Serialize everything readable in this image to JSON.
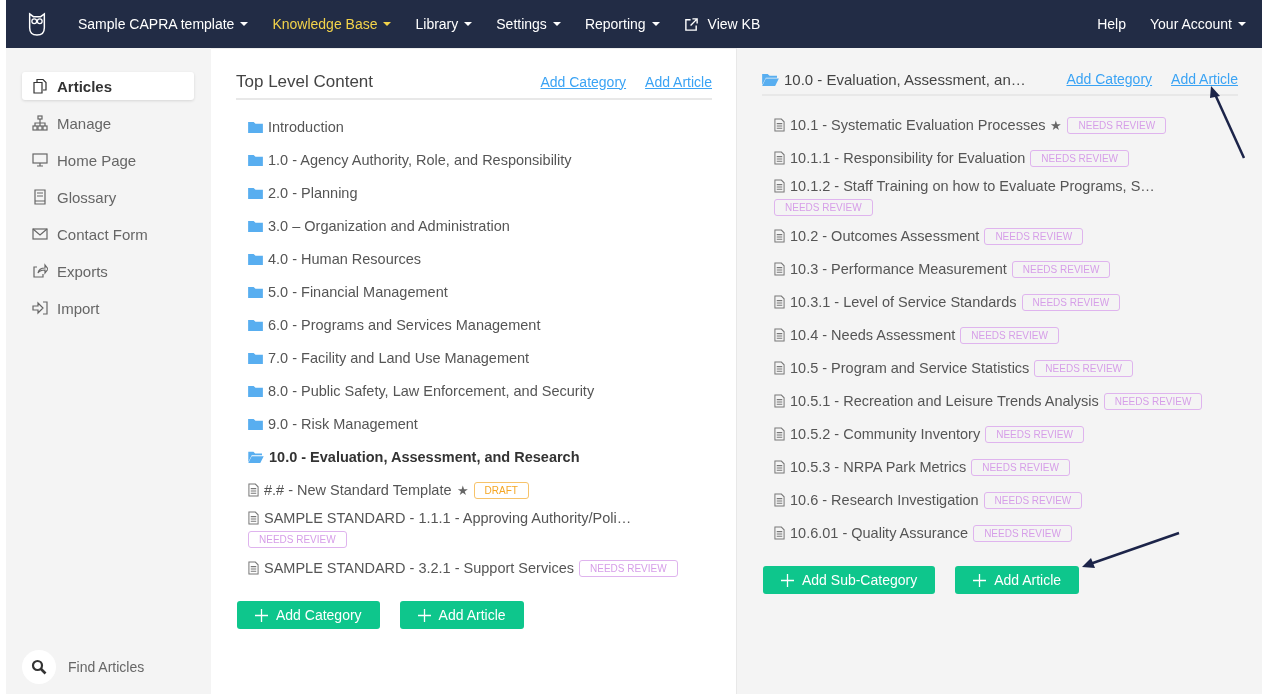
{
  "nav": {
    "items": [
      {
        "label": "Sample CAPRA template",
        "kind": "dropdown",
        "selected": false
      },
      {
        "label": "Knowledge Base",
        "kind": "dropdown",
        "selected": true
      },
      {
        "label": "Library",
        "kind": "dropdown",
        "selected": false
      },
      {
        "label": "Settings",
        "kind": "dropdown",
        "selected": false
      },
      {
        "label": "Reporting",
        "kind": "dropdown",
        "selected": false
      },
      {
        "label": "View KB",
        "kind": "external",
        "selected": false
      }
    ],
    "right": [
      {
        "label": "Help",
        "kind": "link"
      },
      {
        "label": "Your Account",
        "kind": "dropdown"
      }
    ]
  },
  "sidebar": {
    "items": [
      {
        "label": "Articles",
        "selected": true
      },
      {
        "label": "Manage",
        "selected": false
      },
      {
        "label": "Home Page",
        "selected": false
      },
      {
        "label": "Glossary",
        "selected": false
      },
      {
        "label": "Contact Form",
        "selected": false
      },
      {
        "label": "Exports",
        "selected": false
      },
      {
        "label": "Import",
        "selected": false
      }
    ],
    "search": {
      "label": "Find Articles"
    }
  },
  "panels": [
    {
      "title": "Top Level Content",
      "kind": "plain",
      "links": [
        "Add Category",
        "Add Article"
      ],
      "items": [
        {
          "kind": "folder",
          "label": "Introduction",
          "open": false
        },
        {
          "kind": "folder",
          "label": "1.0 - Agency Authority, Role, and Responsibility",
          "open": false
        },
        {
          "kind": "folder",
          "label": "2.0 - Planning",
          "open": false
        },
        {
          "kind": "folder",
          "label": "3.0 – Organization and Administration",
          "open": false
        },
        {
          "kind": "folder",
          "label": "4.0 - Human Resources",
          "open": false
        },
        {
          "kind": "folder",
          "label": "5.0 - Financial Management",
          "open": false
        },
        {
          "kind": "folder",
          "label": "6.0 - Programs and Services Management",
          "open": false
        },
        {
          "kind": "folder",
          "label": "7.0 - Facility and Land Use Management",
          "open": false
        },
        {
          "kind": "folder",
          "label": "8.0 - Public Safety, Law Enforcement, and Security",
          "open": false
        },
        {
          "kind": "folder",
          "label": "9.0 - Risk Management",
          "open": false
        },
        {
          "kind": "folder",
          "label": "10.0 - Evaluation, Assessment, and Research",
          "open": true
        },
        {
          "kind": "article",
          "label": "#.# - New Standard Template",
          "star": "★",
          "badge": {
            "text": "DRAFT",
            "kind": "draft"
          }
        },
        {
          "kind": "article",
          "label": "SAMPLE STANDARD - 1.1.1 - Approving Authority/Poli…",
          "badge": {
            "text": "NEEDS REVIEW",
            "kind": "review"
          }
        },
        {
          "kind": "article",
          "label": "SAMPLE STANDARD - 3.2.1 - Support Services",
          "badge": {
            "text": "NEEDS REVIEW",
            "kind": "review"
          }
        }
      ],
      "buttons": [
        "Add Category",
        "Add Article"
      ]
    },
    {
      "title": "10.0 - Evaluation, Assessment, an…",
      "kind": "folder",
      "links": [
        "Add Category",
        "Add Article"
      ],
      "items": [
        {
          "kind": "article",
          "label": "10.1 - Systematic Evaluation Processes",
          "star": "★",
          "badge": {
            "text": "NEEDS REVIEW",
            "kind": "review"
          }
        },
        {
          "kind": "article",
          "label": "10.1.1 - Responsibility for Evaluation",
          "badge": {
            "text": "NEEDS REVIEW",
            "kind": "review"
          }
        },
        {
          "kind": "article",
          "label": "10.1.2 - Staff Training on how to Evaluate Programs, S…",
          "badge": {
            "text": "NEEDS REVIEW",
            "kind": "review"
          }
        },
        {
          "kind": "article",
          "label": "10.2 - Outcomes Assessment",
          "badge": {
            "text": "NEEDS REVIEW",
            "kind": "review"
          }
        },
        {
          "kind": "article",
          "label": "10.3 - Performance Measurement",
          "badge": {
            "text": "NEEDS REVIEW",
            "kind": "review"
          }
        },
        {
          "kind": "article",
          "label": "10.3.1 - Level of Service Standards",
          "badge": {
            "text": "NEEDS REVIEW",
            "kind": "review"
          }
        },
        {
          "kind": "article",
          "label": "10.4 - Needs Assessment",
          "badge": {
            "text": "NEEDS REVIEW",
            "kind": "review"
          }
        },
        {
          "kind": "article",
          "label": "10.5 - Program and Service Statistics",
          "badge": {
            "text": "NEEDS REVIEW",
            "kind": "review"
          }
        },
        {
          "kind": "article",
          "label": "10.5.1 - Recreation and Leisure Trends Analysis",
          "badge": {
            "text": "NEEDS REVIEW",
            "kind": "review"
          }
        },
        {
          "kind": "article",
          "label": "10.5.2 - Community Inventory",
          "badge": {
            "text": "NEEDS REVIEW",
            "kind": "review"
          }
        },
        {
          "kind": "article",
          "label": "10.5.3 - NRPA Park Metrics",
          "badge": {
            "text": "NEEDS REVIEW",
            "kind": "review"
          }
        },
        {
          "kind": "article",
          "label": "10.6 - Research Investigation",
          "badge": {
            "text": "NEEDS REVIEW",
            "kind": "review"
          }
        },
        {
          "kind": "article",
          "label": "10.6.01 - Quality Assurance",
          "badge": {
            "text": "NEEDS REVIEW",
            "kind": "review"
          }
        }
      ],
      "buttons": [
        "Add Sub-Category",
        "Add Article"
      ]
    }
  ]
}
